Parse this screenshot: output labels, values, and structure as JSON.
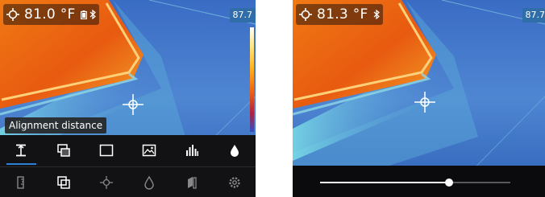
{
  "colors": {
    "accent": "#2b7fd4",
    "toolbar_bg": "#121214",
    "scale_box": "#2f6ea8"
  },
  "left_screen": {
    "temperature": "81.0 °F",
    "status_icons": [
      "battery-icon",
      "bluetooth-icon"
    ],
    "scale_max": "87.7",
    "tooltip": "Alignment distance",
    "toolbar": {
      "top_row": [
        {
          "icon": "alignment-distance-icon",
          "selected": true
        },
        {
          "icon": "picture-in-picture-icon",
          "selected": false
        },
        {
          "icon": "rectangle-icon",
          "selected": false
        },
        {
          "icon": "image-icon",
          "selected": false
        },
        {
          "icon": "histogram-icon",
          "selected": false
        },
        {
          "icon": "droplet-icon",
          "selected": false
        }
      ],
      "bottom_row": [
        {
          "icon": "distance-meter-icon"
        },
        {
          "icon": "overlay-mode-icon"
        },
        {
          "icon": "crosshair-icon"
        },
        {
          "icon": "humidity-icon"
        },
        {
          "icon": "emissivity-icon"
        },
        {
          "icon": "settings-gear-icon"
        }
      ]
    }
  },
  "right_screen": {
    "temperature": "81.3 °F",
    "status_icons": [
      "bluetooth-icon"
    ],
    "scale_max": "87.7",
    "slider": {
      "value_fraction": 0.68
    }
  }
}
